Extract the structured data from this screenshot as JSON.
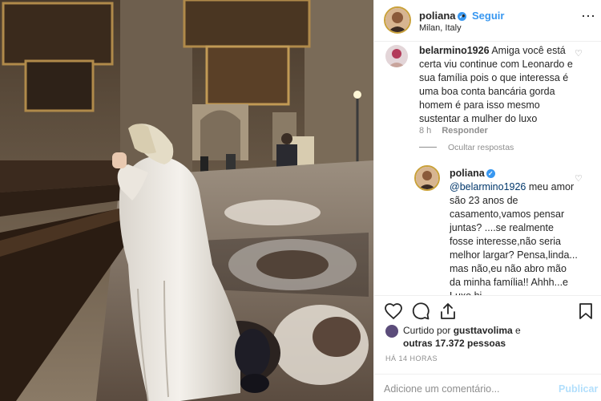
{
  "header": {
    "username": "poliana",
    "dot": "•",
    "follow_label": "Seguir",
    "location": "Milan, Italy",
    "more_icon": "⋯"
  },
  "comments": [
    {
      "username": "belarmino1926",
      "text": "Amiga você está certa viu continue com Leonardo e sua família pois o que interessa é uma boa conta bancária gorda homem é para isso mesmo sustentar a mulher do luxo",
      "time": "8 h",
      "reply_label": "Responder",
      "hide_replies_label": "Ocultar respostas"
    },
    {
      "username": "poliana",
      "mention": "@belarmino1926",
      "text": " meu amor são 23 anos de casamento,vamos pensar juntas? ....se realmente fosse interesse,não seria melhor largar? Pensa,linda... mas não,eu não abro mão da minha família!! Ahhh...e Luxo hj"
    }
  ],
  "liked_by": {
    "prefix": "Curtido por ",
    "user": "gusttavolima",
    "middle": " e",
    "others": "outras 17.372 pessoas"
  },
  "timestamp": "HÁ 14 HORAS",
  "add_comment": {
    "placeholder": "Adicione um comentário...",
    "publish_label": "Publicar"
  },
  "colors": {
    "accent_blue": "#3897f0",
    "publish_disabled": "#b2dffc",
    "muted": "#8e8e8e"
  },
  "icons": [
    "verified-badge-icon",
    "heart-icon",
    "comment-icon",
    "share-icon",
    "bookmark-icon",
    "more-options-icon"
  ]
}
